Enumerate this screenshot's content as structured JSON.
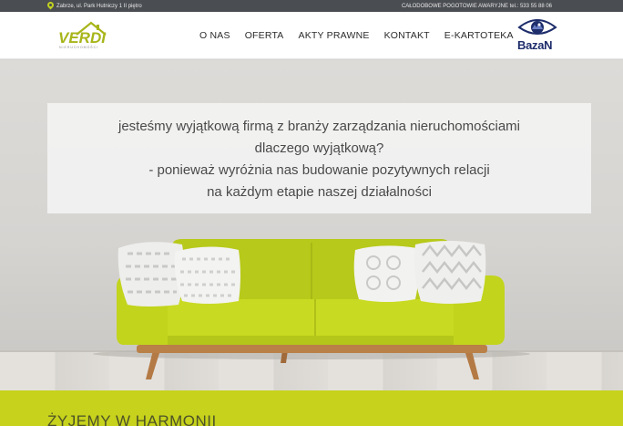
{
  "topbar": {
    "address": "Zabrze, ul. Park Hutniczy 1 II piętro",
    "phone": "CAŁODOBOWE POGOTOWIE AWARYJNE tel.: 533 55 88 06"
  },
  "header": {
    "logo_text": "VERDI",
    "logo_subtext": "NIERUCHOMOŚCI",
    "nav": [
      {
        "label": "O NAS"
      },
      {
        "label": "OFERTA"
      },
      {
        "label": "AKTY PRAWNE"
      },
      {
        "label": "KONTAKT"
      },
      {
        "label": "E-KARTOTEKA"
      }
    ],
    "partner_logo_text": "BazaN"
  },
  "hero": {
    "lines": [
      "jesteśmy wyjątkową firmą z branży zarządzania nieruchomościami",
      "dlaczego wyjątkową?",
      "- ponieważ wyróżnia nas budowanie pozytywnych relacji",
      "na każdym etapie naszej działalności"
    ]
  },
  "section": {
    "heading": "ŻYJEMY W HARMONII"
  },
  "colors": {
    "brand_green": "#c6d21c",
    "topbar": "#4a4d52",
    "sofa": "#bed01c"
  },
  "icons": {
    "address": "map-pin-icon"
  }
}
